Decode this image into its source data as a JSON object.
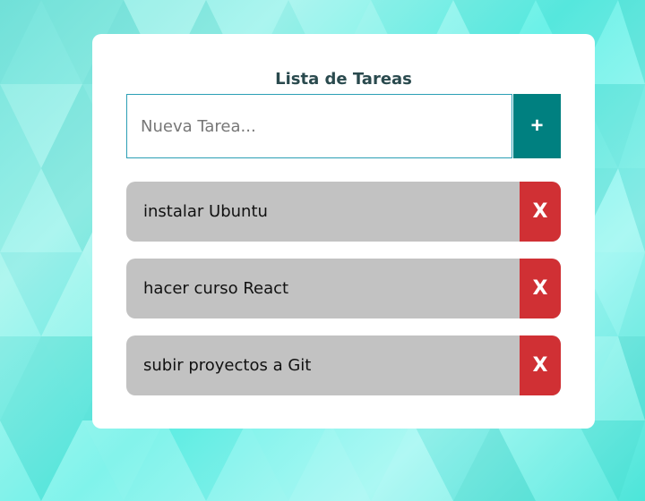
{
  "app": {
    "title": "Lista de Tareas"
  },
  "input": {
    "placeholder": "Nueva Tarea...",
    "value": ""
  },
  "add_button": {
    "label": "+"
  },
  "tasks": [
    {
      "text": "instalar Ubuntu",
      "delete_label": "X"
    },
    {
      "text": "hacer curso React",
      "delete_label": "X"
    },
    {
      "text": "subir proyectos a Git",
      "delete_label": "X"
    }
  ],
  "colors": {
    "accent": "#008080",
    "delete": "#d03034",
    "item_bg": "#c2c2c2",
    "background": "#5ff0e6"
  }
}
